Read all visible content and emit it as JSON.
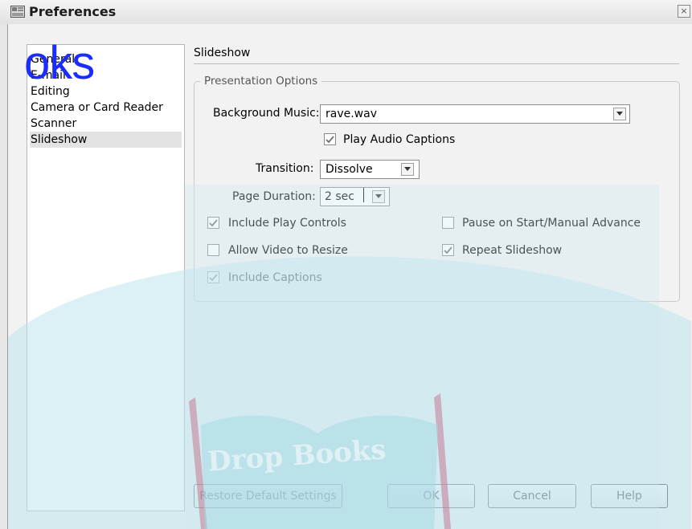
{
  "window": {
    "title": "Preferences",
    "close_glyph": "×"
  },
  "sidebar": {
    "items": [
      {
        "label": "General",
        "selected": false
      },
      {
        "label": "E-mail",
        "selected": false
      },
      {
        "label": "Editing",
        "selected": false
      },
      {
        "label": "Camera or Card Reader",
        "selected": false
      },
      {
        "label": "Scanner",
        "selected": false
      },
      {
        "label": "Slideshow",
        "selected": true
      }
    ]
  },
  "main": {
    "section_title": "Slideshow",
    "group_title": "Presentation Options",
    "background_music": {
      "label": "Background Music:",
      "value": "rave.wav"
    },
    "play_audio_captions": {
      "label": "Play Audio Captions",
      "checked": true
    },
    "transition": {
      "label": "Transition:",
      "value": "Dissolve"
    },
    "page_duration": {
      "label": "Page Duration:",
      "value": "2 sec"
    },
    "options": {
      "include_play_controls": {
        "label": "Include Play Controls",
        "checked": true
      },
      "pause_on_start": {
        "label": "Pause on Start/Manual Advance",
        "checked": false
      },
      "allow_video_resize": {
        "label": "Allow Video to Resize",
        "checked": false
      },
      "repeat_slideshow": {
        "label": "Repeat Slideshow",
        "checked": true
      },
      "include_captions": {
        "label": "Include Captions",
        "checked": true
      }
    }
  },
  "buttons": {
    "restore": "Restore Default Settings",
    "ok": "OK",
    "cancel": "Cancel",
    "help": "Help"
  },
  "watermark": {
    "text": "oks",
    "bottom_text": "Drop Books"
  },
  "colors": {
    "selection": "#e3e3e3",
    "watermark_blue": "#1a2cff",
    "watermark_cyan": "#bfe6ee"
  }
}
